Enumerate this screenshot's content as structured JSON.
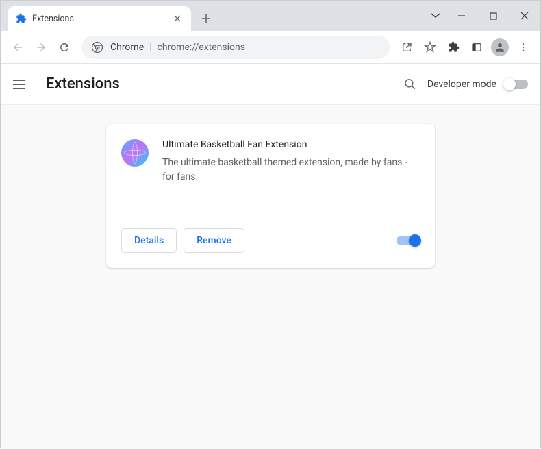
{
  "tab": {
    "title": "Extensions"
  },
  "omnibox": {
    "scheme_label": "Chrome",
    "url_path": "chrome://extensions"
  },
  "header": {
    "title": "Extensions",
    "developer_mode_label": "Developer mode"
  },
  "extension": {
    "name": "Ultimate Basketball Fan Extension",
    "description": "The ultimate basketball themed extension, made by fans - for fans.",
    "details_label": "Details",
    "remove_label": "Remove",
    "enabled": true
  }
}
